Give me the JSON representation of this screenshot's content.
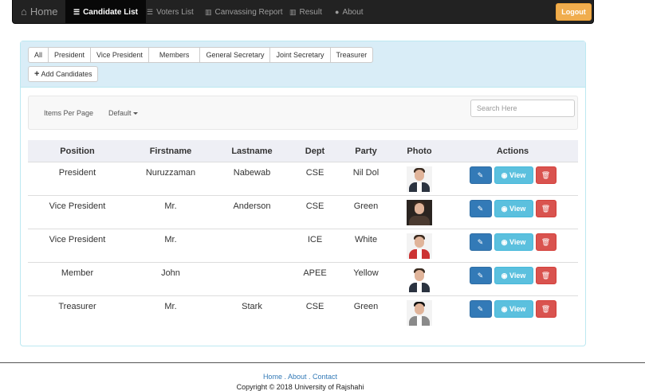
{
  "nav": {
    "brand": "Home",
    "items": [
      "Candidate List",
      "Voters List",
      "Canvassing Report",
      "Result",
      "About"
    ],
    "logout": "Logout"
  },
  "tabs": [
    "All",
    "President",
    "Vice President",
    "Members",
    "General Secretary",
    "Joint Secretary",
    "Treasurer"
  ],
  "add_button": "Add Candidates",
  "filter": {
    "items_per_page": "Items Per Page",
    "default": "Default",
    "search_placeholder": "Search Here"
  },
  "table": {
    "headers": [
      "Position",
      "Firstname",
      "Lastname",
      "Dept",
      "Party",
      "Photo",
      "Actions"
    ],
    "rows": [
      {
        "position": "President",
        "firstname": "Nuruzzaman",
        "lastname": "Nabewab",
        "dept": "CSE",
        "party": "Nil Dol"
      },
      {
        "position": "Vice President",
        "firstname": "Mr.",
        "lastname": "Anderson",
        "dept": "CSE",
        "party": "Green"
      },
      {
        "position": "Vice President",
        "firstname": "Mr.",
        "lastname": "",
        "dept": "ICE",
        "party": "White"
      },
      {
        "position": "Member",
        "firstname": "John",
        "lastname": "",
        "dept": "APEE",
        "party": "Yellow"
      },
      {
        "position": "Treasurer",
        "firstname": "Mr.",
        "lastname": "Stark",
        "dept": "CSE",
        "party": "Green"
      }
    ],
    "view_label": "View"
  },
  "footer": {
    "links": [
      "Home",
      "About",
      "Contact"
    ],
    "copyright": "Copyright © 2018 University of Rajshahi"
  }
}
